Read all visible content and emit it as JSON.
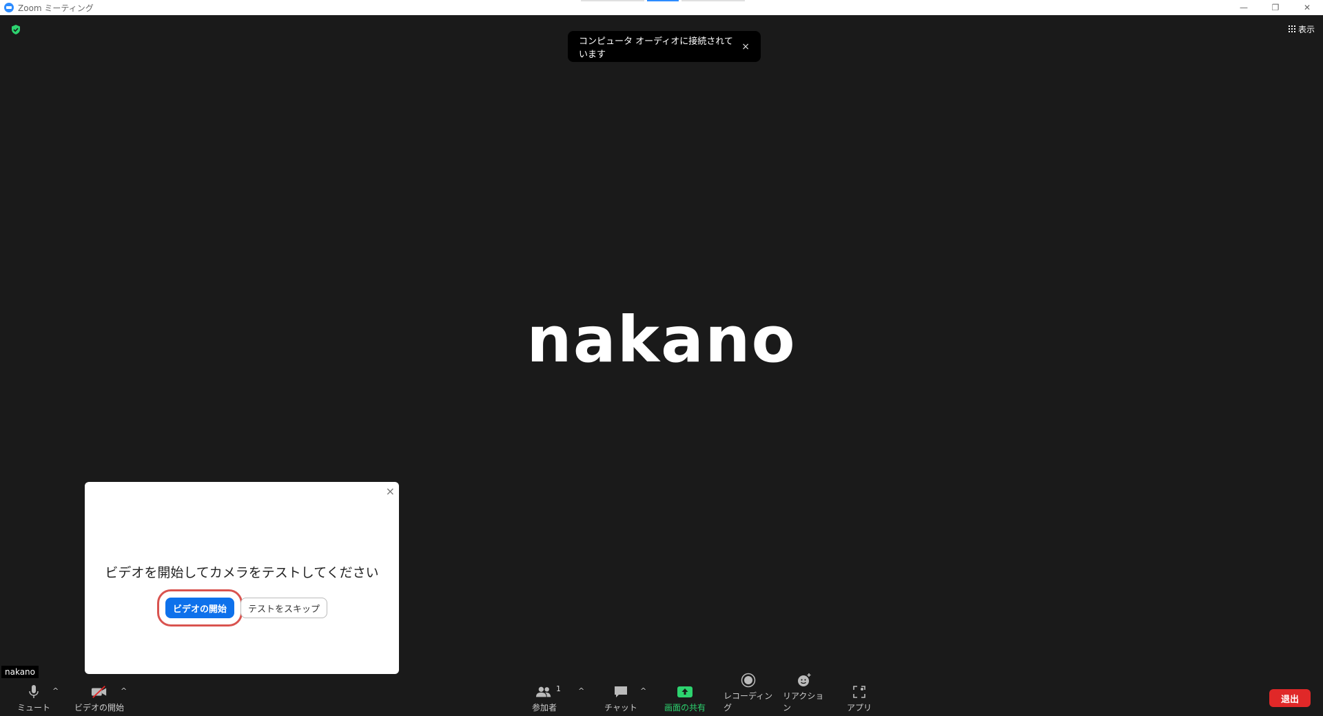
{
  "window": {
    "title": "Zoom ミーティング",
    "controls": {
      "minimize": "—",
      "restore": "❐",
      "close": "✕"
    }
  },
  "view_button": {
    "label": "表示"
  },
  "toast": {
    "message": "コンピュータ オーディオに接続されています",
    "close": "×"
  },
  "participant": {
    "display_name": "nakano"
  },
  "dialog": {
    "message": "ビデオを開始してカメラをテストしてください",
    "start_video_label": "ビデオの開始",
    "skip_test_label": "テストをスキップ",
    "close": "×"
  },
  "self_label": "nakano",
  "toolbar": {
    "mute_label": "ミュート",
    "video_label": "ビデオの開始",
    "participants_label": "参加者",
    "participants_count": "1",
    "chat_label": "チャット",
    "share_label": "画面の共有",
    "record_label": "レコーディング",
    "reactions_label": "リアクション",
    "apps_label": "アプリ",
    "leave_label": "退出",
    "caret": "^"
  },
  "colors": {
    "background": "#1a1a1a",
    "primary": "#0e71eb",
    "share_green": "#2dd36f",
    "leave_red": "#e02828",
    "highlight": "#d9534f"
  }
}
